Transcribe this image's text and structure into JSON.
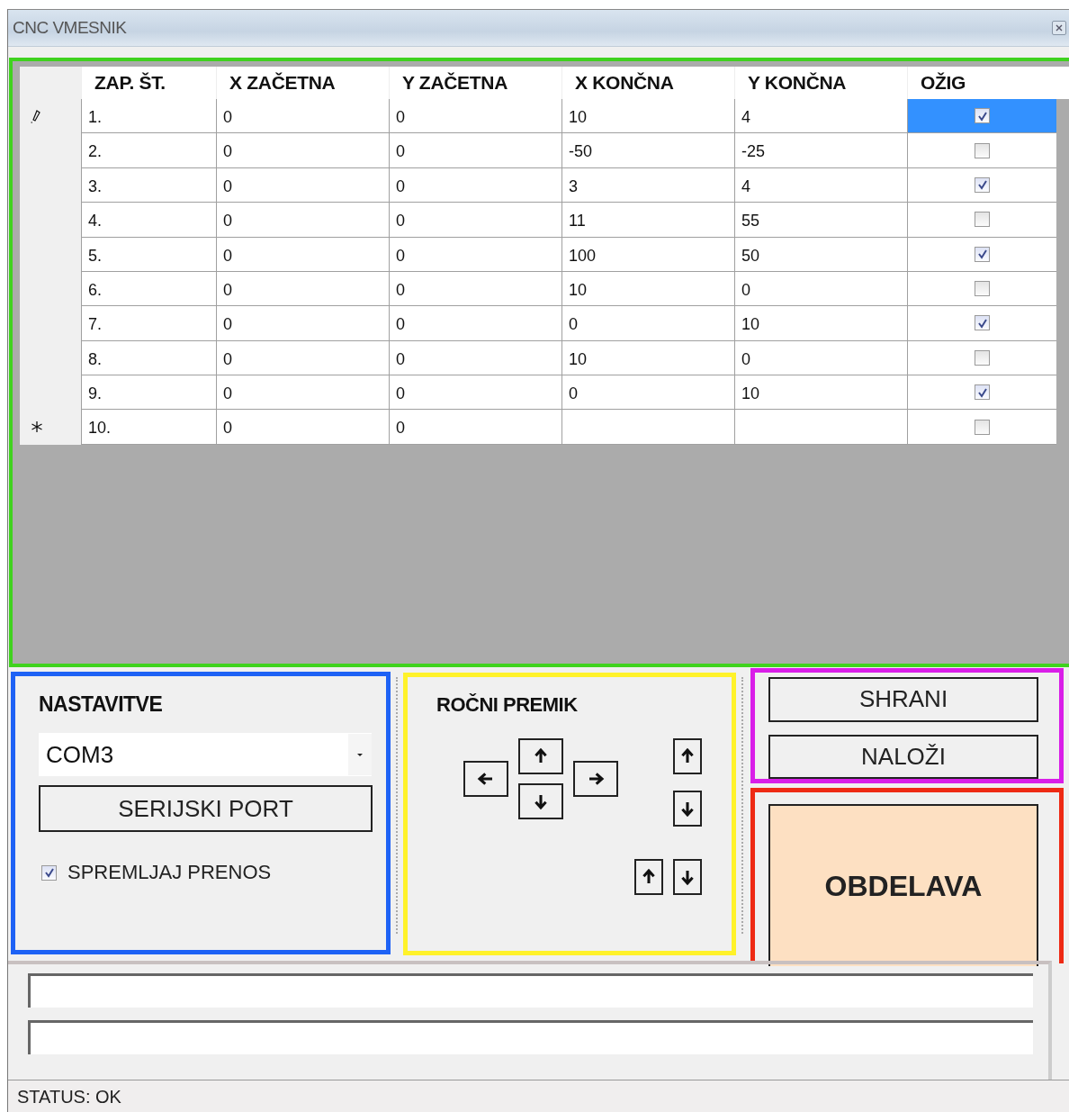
{
  "window": {
    "title": "CNC VMESNIK"
  },
  "table": {
    "columns": [
      "ZAP. ŠT.",
      "X ZAČETNA",
      "Y ZAČETNA",
      "X KONČNA",
      "Y KONČNA",
      "OŽIG"
    ],
    "rows": [
      {
        "kind": "editing",
        "cells": [
          "1.",
          "0",
          "0",
          "10",
          "4"
        ],
        "checked": true,
        "selected": true
      },
      {
        "cells": [
          "2.",
          "0",
          "0",
          "-50",
          "-25"
        ],
        "checked": false,
        "selected": false
      },
      {
        "cells": [
          "3.",
          "0",
          "0",
          "3",
          "4"
        ],
        "checked": true,
        "selected": false
      },
      {
        "cells": [
          "4.",
          "0",
          "0",
          "11",
          "55"
        ],
        "checked": false,
        "selected": false
      },
      {
        "cells": [
          "5.",
          "0",
          "0",
          "100",
          "50"
        ],
        "checked": true,
        "selected": false
      },
      {
        "cells": [
          "6.",
          "0",
          "0",
          "10",
          "0"
        ],
        "checked": false,
        "selected": false
      },
      {
        "cells": [
          "7.",
          "0",
          "0",
          "0",
          "10"
        ],
        "checked": true,
        "selected": false
      },
      {
        "cells": [
          "8.",
          "0",
          "0",
          "10",
          "0"
        ],
        "checked": false,
        "selected": false
      },
      {
        "cells": [
          "9.",
          "0",
          "0",
          "0",
          "10"
        ],
        "checked": true,
        "selected": false
      },
      {
        "kind": "new",
        "cells": [
          "10.",
          "0",
          "0",
          null,
          null
        ],
        "checked": false,
        "selected": false
      }
    ]
  },
  "settings": {
    "title": "NASTAVITVE",
    "port": "COM3",
    "port_button": "SERIJSKI PORT",
    "log_checkbox": {
      "label": "SPREMLJAJ PRENOS",
      "checked": true
    }
  },
  "manual_move": {
    "title": "ROČNI PREMIK"
  },
  "file_buttons": [
    "SHRANI",
    "NALOŽI"
  ],
  "process_button": "OBDELAVA",
  "status_bar": "STATUS: OK"
}
